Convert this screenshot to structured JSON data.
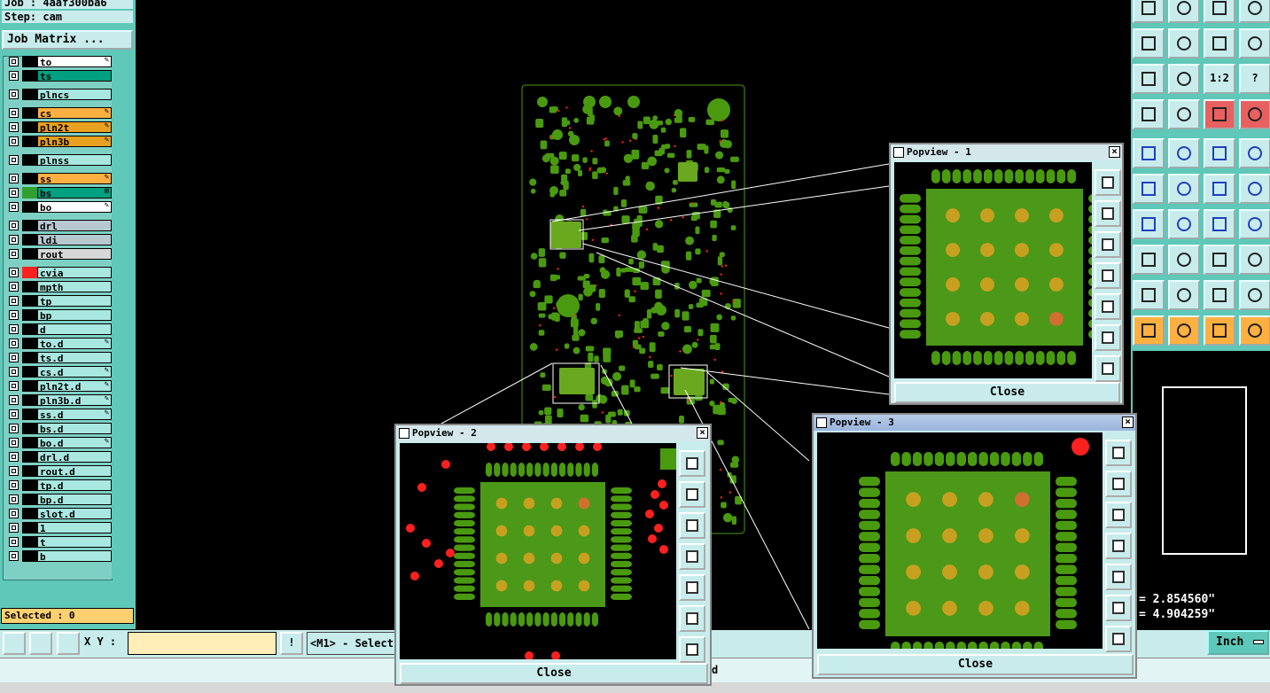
{
  "header": {
    "job_label": "Job : 4aaf300ba6",
    "step_label": "Step: cam",
    "job_matrix_button": "Job Matrix ..."
  },
  "layers": [
    {
      "name": "to",
      "color": "#000000",
      "bg": "#ffffff",
      "mark": "✎"
    },
    {
      "name": "ts",
      "color": "#000000",
      "bg": "#00a080",
      "mark": ""
    },
    {
      "name": "plncs",
      "color": "#000000",
      "bg": "#a8e8e0",
      "mark": ""
    },
    {
      "name": "cs",
      "color": "#000000",
      "bg": "#ffb040",
      "mark": "✎"
    },
    {
      "name": "pln2t",
      "color": "#000000",
      "bg": "#e8a020",
      "mark": "✎"
    },
    {
      "name": "pln3b",
      "color": "#000000",
      "bg": "#e8a020",
      "mark": "✎"
    },
    {
      "name": "plnss",
      "color": "#000000",
      "bg": "#a8e8e0",
      "mark": ""
    },
    {
      "name": "ss",
      "color": "#000000",
      "bg": "#ffb040",
      "mark": "✎"
    },
    {
      "name": "bs",
      "color": "#30a030",
      "bg": "#00a080",
      "mark": "⊞"
    },
    {
      "name": "bo",
      "color": "#000000",
      "bg": "#ffffff",
      "mark": "✎"
    },
    {
      "name": "drl",
      "color": "#000000",
      "bg": "#b8c8d0",
      "mark": ""
    },
    {
      "name": "ldi",
      "color": "#000000",
      "bg": "#b8c8d0",
      "mark": ""
    },
    {
      "name": "rout",
      "color": "#000000",
      "bg": "#d8d8d8",
      "mark": ""
    },
    {
      "name": "cvia",
      "color": "#ff2020",
      "bg": "#a8e8e0",
      "mark": ""
    },
    {
      "name": "mpth",
      "color": "#000000",
      "bg": "#a8e8e0",
      "mark": ""
    },
    {
      "name": "tp",
      "color": "#000000",
      "bg": "#a8e8e0",
      "mark": ""
    },
    {
      "name": "bp",
      "color": "#000000",
      "bg": "#a8e8e0",
      "mark": ""
    },
    {
      "name": "d",
      "color": "#000000",
      "bg": "#a8e8e0",
      "mark": ""
    },
    {
      "name": "to.d",
      "color": "#000000",
      "bg": "#a8e8e0",
      "mark": "✎"
    },
    {
      "name": "ts.d",
      "color": "#000000",
      "bg": "#a8e8e0",
      "mark": ""
    },
    {
      "name": "cs.d",
      "color": "#000000",
      "bg": "#a8e8e0",
      "mark": "✎"
    },
    {
      "name": "pln2t.d",
      "color": "#000000",
      "bg": "#a8e8e0",
      "mark": "✎"
    },
    {
      "name": "pln3b.d",
      "color": "#000000",
      "bg": "#a8e8e0",
      "mark": "✎"
    },
    {
      "name": "ss.d",
      "color": "#000000",
      "bg": "#a8e8e0",
      "mark": "✎"
    },
    {
      "name": "bs.d",
      "color": "#000000",
      "bg": "#a8e8e0",
      "mark": ""
    },
    {
      "name": "bo.d",
      "color": "#000000",
      "bg": "#a8e8e0",
      "mark": "✎"
    },
    {
      "name": "drl.d",
      "color": "#000000",
      "bg": "#a8e8e0",
      "mark": ""
    },
    {
      "name": "rout.d",
      "color": "#000000",
      "bg": "#a8e8e0",
      "mark": ""
    },
    {
      "name": "tp.d",
      "color": "#000000",
      "bg": "#a8e8e0",
      "mark": ""
    },
    {
      "name": "bp.d",
      "color": "#000000",
      "bg": "#a8e8e0",
      "mark": ""
    },
    {
      "name": "slot.d",
      "color": "#000000",
      "bg": "#a8e8e0",
      "mark": ""
    },
    {
      "name": "1",
      "color": "#000000",
      "bg": "#a8e8e0",
      "mark": ""
    },
    {
      "name": "t",
      "color": "#000000",
      "bg": "#a8e8e0",
      "mark": ""
    },
    {
      "name": "b",
      "color": "#000000",
      "bg": "#a8e8e0",
      "mark": ""
    }
  ],
  "status": {
    "selected": "Selected : 0",
    "xy_label": "X Y :",
    "xy_value": "",
    "mouse_hint": "<M1> - Select",
    "coord_x": "= 2.854560\"",
    "coord_y": "= 4.904259\"",
    "units": "Inch",
    "status_fragment": "d"
  },
  "popviews": [
    {
      "title": "Popview - 1",
      "close": "Close"
    },
    {
      "title": "Popview - 2",
      "close": "Close"
    },
    {
      "title": "Popview - 3",
      "close": "Close"
    }
  ],
  "right_tools_labels": {
    "ratio": "1:2",
    "help": "?"
  },
  "colors": {
    "panel": "#5fc8b8",
    "pcb_green": "#4a9a10",
    "pad_gold": "#c8a020",
    "via_red": "#ff2020"
  }
}
